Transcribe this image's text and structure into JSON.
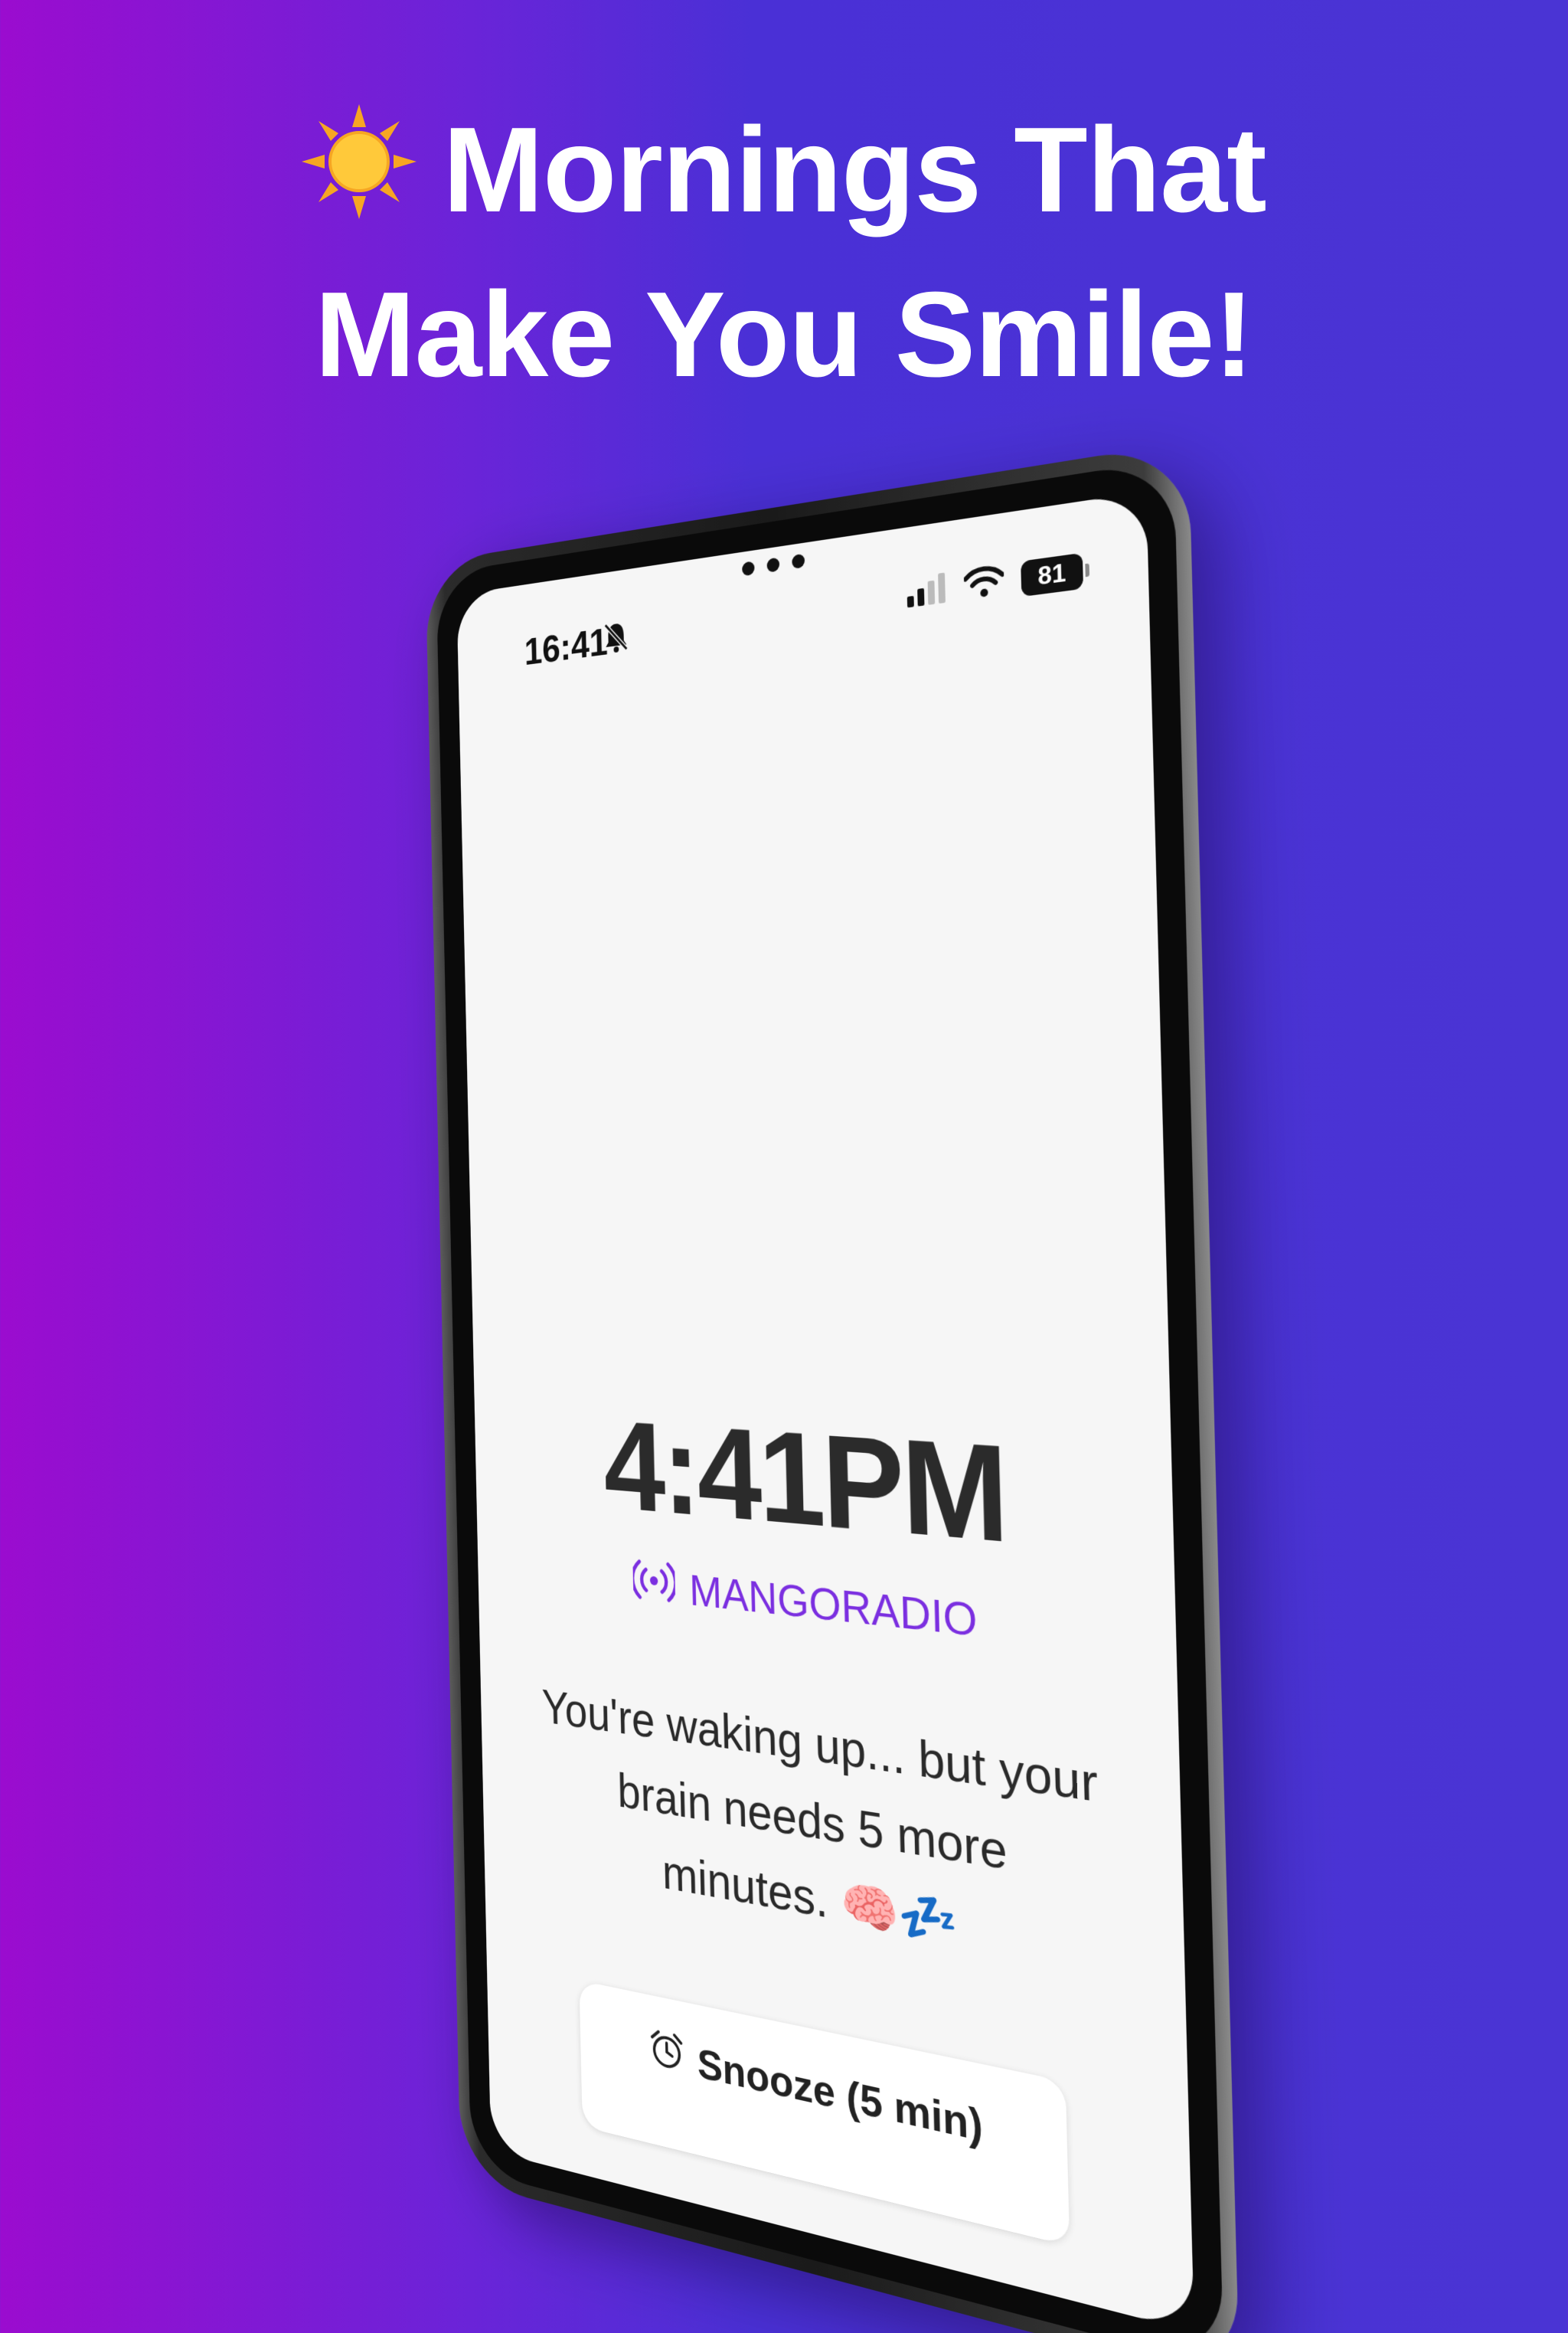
{
  "headline": {
    "line1_emoji_icon": "sun-icon",
    "line1_text": "Mornings That",
    "line2_text": "Make You Smile!"
  },
  "device": {
    "status_bar": {
      "time": "16:41",
      "silent_icon": "bell-slash-icon",
      "signal_icon": "cellular-signal-icon",
      "wifi_icon": "wifi-icon",
      "battery_level": "81"
    },
    "screen": {
      "clock": "4:41PM",
      "station_icon": "broadcast-icon",
      "station_name": "MANGORADIO",
      "message": "You're waking up... but your brain needs 5 more minutes. 🧠💤",
      "snooze_icon": "alarm-clock-icon",
      "snooze_label": "Snooze (5 min)"
    }
  },
  "colors": {
    "background_left": "#9b0ccf",
    "background_right": "#4a34d4",
    "accent_purple": "#7b2fe0",
    "headline_text": "#ffffff"
  }
}
